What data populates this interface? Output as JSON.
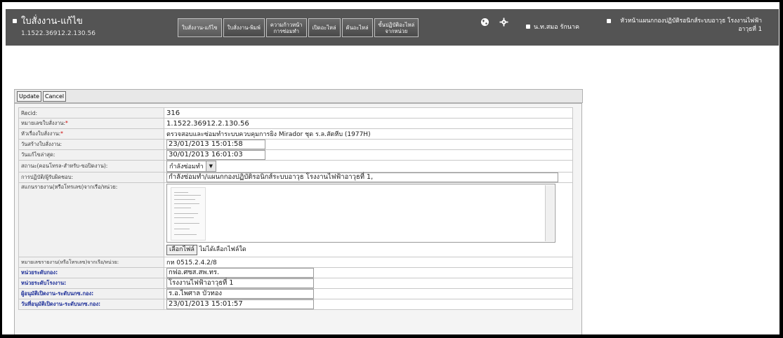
{
  "header": {
    "title": "ใบสั่งงาน-แก้ไข",
    "subtitle": "1.1522.36912.2.130.56",
    "nav": [
      {
        "label": "ใบสั่งงาน-แก้ไข"
      },
      {
        "label": "ใบสั่งงาน-พิมพ์"
      },
      {
        "label": "ความก้าวหน้า\nการซ่อมทำ"
      },
      {
        "label": "เปิดอะไหล่"
      },
      {
        "label": "ค้นอะไหล่"
      },
      {
        "label": "ขั้นปฏิบัติอะไหล่\nจากหน่วย"
      }
    ],
    "icons": [
      "globe-icon",
      "gear-icon"
    ],
    "user": "น.ท.สมอ รักนาค",
    "role": "หัวหน้าแผนกกองปฏิบัติรอนิกส์ระบบอาวุธ โรงงานไฟฟ้าอาวุธที่ 1"
  },
  "toolbar": {
    "update_label": "Update",
    "cancel_label": "Cancel"
  },
  "form": {
    "recid_label": "Recid:",
    "recid_value": "316",
    "wo_number_label": "หมายเลขใบสั่งงาน:",
    "wo_number_value": "1.1522.36912.2.130.56",
    "wo_subject_label": "หัวเรื่องใบสั่งงาน:",
    "wo_subject_value": "ตรวจสอบและซ่อมทำระบบควบคุมการยิง Mirador ชุด ร.ล.สัตหีบ (1977H)",
    "created_label": "วันสร้างใบสั่งงาน:",
    "created_value": "23/01/2013 15:01:58",
    "modified_label": "วันแก้ไขล่าสุด:",
    "modified_value": "30/01/2013 16:01:03",
    "status_label": "สถานะ(คอนโทรล-สำหรับ-ขอปิดงาน):",
    "status_value": "กำลังซ่อมทำ",
    "action_label": "การปฏิบัติ/ผู้รับผิดชอบ:",
    "action_value": "กำลังซ่อมทำ/แผนกกองปฏิบัติรอนิกส์ระบบอาวุธ โรงงานไฟฟ้าอาวุธที่ 1,",
    "scan_label": "สแกนรายงาน(หรือโทรเลข)จากเรือ/หน่วย:",
    "file_button": "เลือกไฟล์",
    "file_status": "ไม่ได้เลือกไฟล์ใด",
    "report_no_label": "หมายเลขรายงาน(หรือโทรเลข)จากเรือ/หน่วย:",
    "report_no_value": "กห 0515.2.4.2/8",
    "unit_label": "หน่วยระดับกอง:",
    "unit_value": "กฟอ.ศซส.สพ.ทร.",
    "dept_label": "หน่วยระดับโรงงาน:",
    "dept_value": "โรงงานไฟฟ้าอาวุธที่ 1",
    "opener_label": "ผู้อนุมัติเปิดงาน-ระดับนกซ.กอง:",
    "opener_value": "ร.อ.ไพศาล บัวทอง",
    "open_date_label": "วันที่อนุมัติเปิดงาน-ระดับนกซ.กอง:",
    "open_date_value": "23/01/2013 15:01:57"
  }
}
